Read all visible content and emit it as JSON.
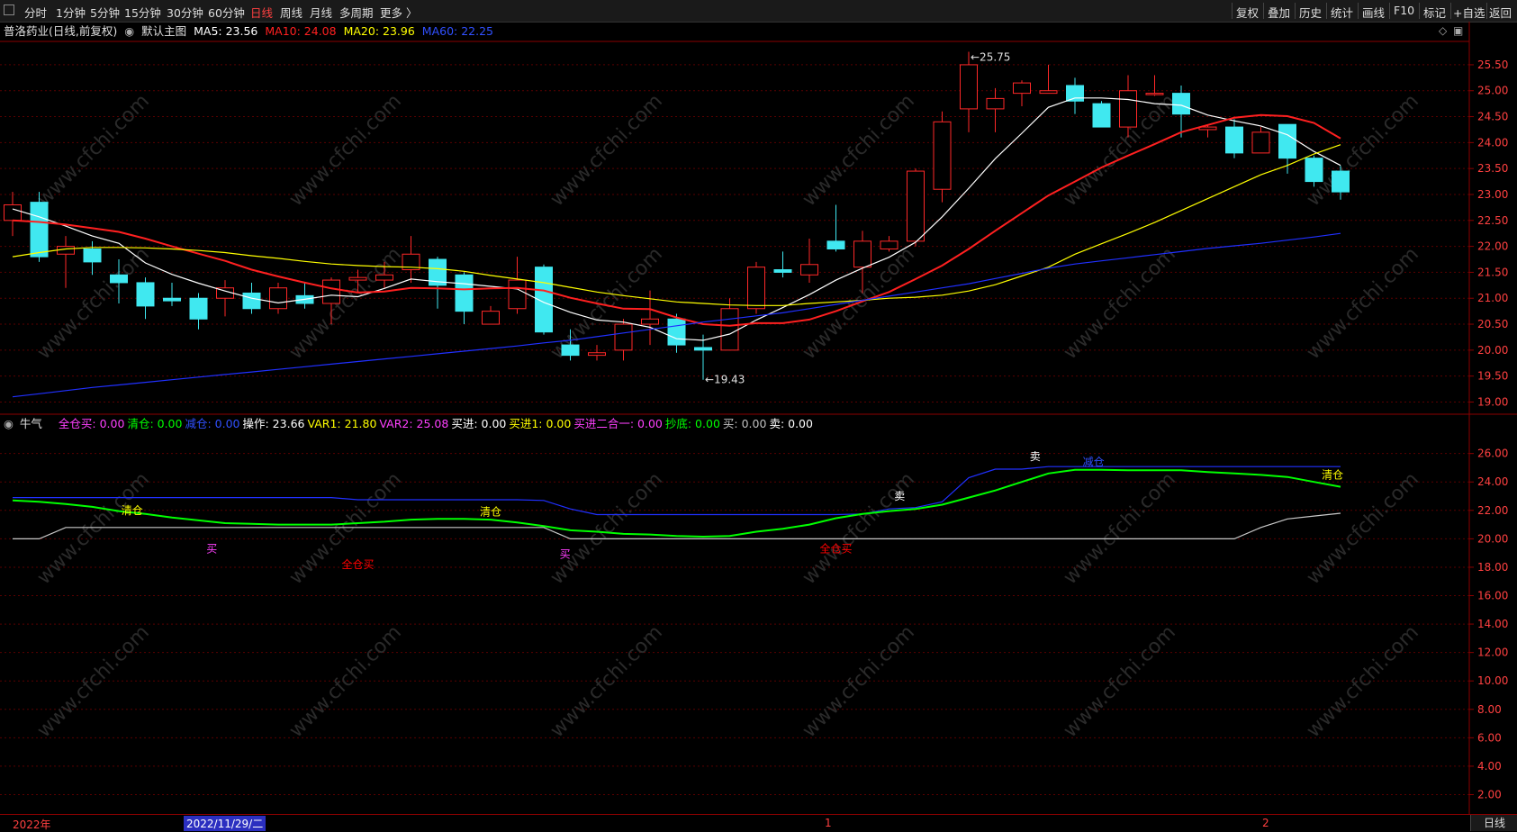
{
  "toolbar": {
    "periods": [
      "分时",
      "1分钟",
      "5分钟",
      "15分钟",
      "30分钟",
      "60分钟",
      "日线",
      "周线",
      "月线",
      "多周期",
      "更多 〉"
    ],
    "active_period": "日线",
    "right_buttons": [
      "复权",
      "叠加",
      "历史",
      "统计",
      "画线",
      "F10",
      "标记",
      "+自选",
      "返回"
    ]
  },
  "main_legend": {
    "title": "普洛药业(日线,前复权)",
    "chart_name": "默认主图",
    "ma5": "MA5: 23.56",
    "ma10": "MA10: 24.08",
    "ma20": "MA20: 23.96",
    "ma60": "MA60: 22.25"
  },
  "indicator_legend": {
    "name": "牛气",
    "items": [
      {
        "text": "全仓买: 0.00",
        "color": "#ff40ff"
      },
      {
        "text": "清仓: 0.00",
        "color": "#00ff00"
      },
      {
        "text": "减仓: 0.00",
        "color": "#3050ff"
      },
      {
        "text": "操作: 23.66",
        "color": "#ffffff"
      },
      {
        "text": "VAR1: 21.80",
        "color": "#ffff00"
      },
      {
        "text": "VAR2: 25.08",
        "color": "#ff40ff"
      },
      {
        "text": "买进: 0.00",
        "color": "#ffffff"
      },
      {
        "text": "买进1: 0.00",
        "color": "#ffff00"
      },
      {
        "text": "买进二合一: 0.00",
        "color": "#ff40ff"
      },
      {
        "text": "抄底: 0.00",
        "color": "#00ff00"
      },
      {
        "text": "买: 0.00",
        "color": "#c0c0c0"
      },
      {
        "text": "卖: 0.00",
        "color": "#ffffff"
      }
    ]
  },
  "statusbar": {
    "year_label": "2022年",
    "cursor_date": "2022/11/29/二",
    "month_marks": [
      "1",
      "2"
    ],
    "period_label": "日线"
  },
  "chart_data": [
    {
      "type": "candlestick",
      "title": "普洛药业(日线,前复权)",
      "ylim": [
        18.8,
        25.95
      ],
      "y_ticks": [
        19.0,
        19.5,
        20.0,
        20.5,
        21.0,
        21.5,
        22.0,
        22.5,
        23.0,
        23.5,
        24.0,
        24.5,
        25.0,
        25.5
      ],
      "max_label": "25.75",
      "min_label": "19.43",
      "candles": [
        [
          22.5,
          22.8,
          22.2,
          23.05
        ],
        [
          22.85,
          21.8,
          21.7,
          23.05
        ],
        [
          21.85,
          22.0,
          21.2,
          22.2
        ],
        [
          21.95,
          21.7,
          21.45,
          22.1
        ],
        [
          21.45,
          21.3,
          20.9,
          21.75
        ],
        [
          21.3,
          20.85,
          20.6,
          21.4
        ],
        [
          21.0,
          20.95,
          20.85,
          21.3
        ],
        [
          21.0,
          20.6,
          20.4,
          21.1
        ],
        [
          21.0,
          21.2,
          20.65,
          21.35
        ],
        [
          21.1,
          20.8,
          20.7,
          21.3
        ],
        [
          20.8,
          21.2,
          20.7,
          21.3
        ],
        [
          21.05,
          20.9,
          20.8,
          21.3
        ],
        [
          20.9,
          21.35,
          20.5,
          21.4
        ],
        [
          21.35,
          21.4,
          21.1,
          21.55
        ],
        [
          21.35,
          21.45,
          21.2,
          21.7
        ],
        [
          21.55,
          21.85,
          21.3,
          22.2
        ],
        [
          21.75,
          21.25,
          20.8,
          21.8
        ],
        [
          21.45,
          20.75,
          20.5,
          21.5
        ],
        [
          20.5,
          20.75,
          20.5,
          20.85
        ],
        [
          20.8,
          21.35,
          20.7,
          21.8
        ],
        [
          21.6,
          20.35,
          20.3,
          21.65
        ],
        [
          20.1,
          19.9,
          19.8,
          20.4
        ],
        [
          19.9,
          19.95,
          19.8,
          20.1
        ],
        [
          20.0,
          20.5,
          19.8,
          20.6
        ],
        [
          20.5,
          20.6,
          20.1,
          21.15
        ],
        [
          20.6,
          20.1,
          19.95,
          20.7
        ],
        [
          20.05,
          20.0,
          19.43,
          20.3
        ],
        [
          20.0,
          20.8,
          20.0,
          21.0
        ],
        [
          20.8,
          21.6,
          20.7,
          21.7
        ],
        [
          21.55,
          21.5,
          21.4,
          21.9
        ],
        [
          21.45,
          21.65,
          21.3,
          22.15
        ],
        [
          22.1,
          21.95,
          21.9,
          22.8
        ],
        [
          21.6,
          22.1,
          21.1,
          22.3
        ],
        [
          21.95,
          22.1,
          21.9,
          22.2
        ],
        [
          22.1,
          23.45,
          22.0,
          23.5
        ],
        [
          23.1,
          24.4,
          22.85,
          24.6
        ],
        [
          24.65,
          25.5,
          24.2,
          25.75
        ],
        [
          24.65,
          24.85,
          24.2,
          25.05
        ],
        [
          24.95,
          25.15,
          24.7,
          25.2
        ],
        [
          24.95,
          25.0,
          24.95,
          25.5
        ],
        [
          25.1,
          24.8,
          24.55,
          25.25
        ],
        [
          24.75,
          24.3,
          24.3,
          24.8
        ],
        [
          24.3,
          25.0,
          24.1,
          25.3
        ],
        [
          24.95,
          24.95,
          24.9,
          25.3
        ],
        [
          24.95,
          24.55,
          24.1,
          25.1
        ],
        [
          24.25,
          24.3,
          24.1,
          24.35
        ],
        [
          24.3,
          23.8,
          23.7,
          24.45
        ],
        [
          23.8,
          24.2,
          23.85,
          24.3
        ],
        [
          24.35,
          23.7,
          23.4,
          24.35
        ],
        [
          23.7,
          23.25,
          23.15,
          23.75
        ],
        [
          23.45,
          23.05,
          22.9,
          23.55
        ]
      ],
      "series": [
        {
          "name": "MA5",
          "color": "#ffffff",
          "values": [
            22.72,
            22.57,
            22.39,
            22.2,
            22.06,
            21.68,
            21.46,
            21.29,
            21.14,
            21.0,
            20.91,
            20.98,
            21.06,
            21.03,
            21.19,
            21.37,
            21.32,
            21.28,
            21.23,
            21.18,
            20.92,
            20.73,
            20.58,
            20.54,
            20.44,
            20.22,
            20.19,
            20.31,
            20.58,
            20.82,
            21.07,
            21.35,
            21.58,
            21.79,
            22.08,
            22.57,
            23.12,
            23.69,
            24.18,
            24.68,
            24.86,
            24.86,
            24.83,
            24.75,
            24.72,
            24.53,
            24.42,
            24.32,
            24.15,
            23.83,
            23.56
          ]
        },
        {
          "name": "MA10",
          "color": "#ff2020",
          "values": [
            22.5,
            22.47,
            22.42,
            22.35,
            22.28,
            22.15,
            22.0,
            21.86,
            21.72,
            21.55,
            21.42,
            21.3,
            21.19,
            21.11,
            21.13,
            21.2,
            21.19,
            21.17,
            21.19,
            21.2,
            21.15,
            21.01,
            20.9,
            20.8,
            20.79,
            20.63,
            20.5,
            20.47,
            20.52,
            20.52,
            20.59,
            20.75,
            20.94,
            21.12,
            21.37,
            21.63,
            21.95,
            22.3,
            22.64,
            22.98,
            23.25,
            23.52,
            23.75,
            23.97,
            24.2,
            24.34,
            24.48,
            24.53,
            24.51,
            24.38,
            24.08
          ]
        },
        {
          "name": "MA20",
          "color": "#ffff00",
          "values": [
            21.8,
            21.88,
            21.95,
            21.98,
            21.98,
            21.97,
            21.95,
            21.92,
            21.88,
            21.82,
            21.77,
            21.71,
            21.66,
            21.63,
            21.61,
            21.6,
            21.57,
            21.52,
            21.44,
            21.37,
            21.3,
            21.21,
            21.12,
            21.05,
            20.99,
            20.93,
            20.9,
            20.87,
            20.86,
            20.86,
            20.9,
            20.93,
            20.96,
            21.0,
            21.02,
            21.06,
            21.14,
            21.26,
            21.43,
            21.6,
            21.85,
            22.05,
            22.25,
            22.46,
            22.69,
            22.92,
            23.15,
            23.38,
            23.56,
            23.78,
            23.96
          ]
        },
        {
          "name": "MA60",
          "color": "#2030ff",
          "values": [
            19.1,
            19.16,
            19.22,
            19.28,
            19.33,
            19.38,
            19.43,
            19.48,
            19.53,
            19.58,
            19.63,
            19.68,
            19.73,
            19.78,
            19.83,
            19.88,
            19.93,
            19.98,
            20.03,
            20.08,
            20.14,
            20.19,
            20.26,
            20.33,
            20.4,
            20.47,
            20.54,
            20.6,
            20.66,
            20.72,
            20.8,
            20.88,
            20.96,
            21.04,
            21.12,
            21.2,
            21.28,
            21.38,
            21.48,
            21.58,
            21.66,
            21.72,
            21.78,
            21.84,
            21.9,
            21.96,
            22.01,
            22.06,
            22.12,
            22.18,
            22.25
          ]
        }
      ],
      "annotations": []
    },
    {
      "type": "line",
      "title": "牛气",
      "ylim": [
        0.7,
        27.5
      ],
      "y_ticks": [
        2.0,
        4.0,
        6.0,
        8.0,
        10.0,
        12.0,
        14.0,
        16.0,
        18.0,
        20.0,
        22.0,
        24.0,
        26.0
      ],
      "series": [
        {
          "name": "减仓",
          "color": "#2030ff",
          "values": [
            22.9,
            22.9,
            22.9,
            22.9,
            22.9,
            22.9,
            22.9,
            22.9,
            22.9,
            22.9,
            22.9,
            22.9,
            22.9,
            22.75,
            22.75,
            22.75,
            22.75,
            22.75,
            22.75,
            22.75,
            22.7,
            22.1,
            21.7,
            21.7,
            21.7,
            21.7,
            21.7,
            21.7,
            21.7,
            21.7,
            21.7,
            21.7,
            21.75,
            22.1,
            22.2,
            22.6,
            24.3,
            24.9,
            24.9,
            25.08,
            25.08,
            25.08,
            25.08,
            25.08,
            25.08,
            25.08,
            25.08,
            25.08,
            25.08,
            25.08,
            25.08
          ]
        },
        {
          "name": "清仓",
          "color": "#00ff00",
          "values": [
            22.7,
            22.6,
            22.45,
            22.25,
            21.95,
            21.75,
            21.5,
            21.3,
            21.1,
            21.05,
            21.0,
            21.0,
            21.0,
            21.1,
            21.2,
            21.35,
            21.4,
            21.4,
            21.35,
            21.15,
            20.9,
            20.6,
            20.5,
            20.35,
            20.3,
            20.2,
            20.15,
            20.2,
            20.5,
            20.7,
            21.0,
            21.45,
            21.75,
            21.95,
            22.1,
            22.4,
            22.9,
            23.4,
            24.0,
            24.6,
            24.85,
            24.85,
            24.82,
            24.82,
            24.82,
            24.7,
            24.6,
            24.5,
            24.35,
            24.0,
            23.66
          ]
        },
        {
          "name": "VAR1",
          "color": "#c8c8c8",
          "values": [
            20.0,
            20.0,
            20.8,
            20.8,
            20.8,
            20.8,
            20.8,
            20.8,
            20.8,
            20.8,
            20.8,
            20.8,
            20.8,
            20.8,
            20.8,
            20.8,
            20.8,
            20.8,
            20.8,
            20.8,
            20.8,
            20.0,
            20.0,
            20.0,
            20.0,
            20.0,
            20.0,
            20.0,
            20.0,
            20.0,
            20.0,
            20.0,
            20.0,
            20.0,
            20.0,
            20.0,
            20.0,
            20.0,
            20.0,
            20.0,
            20.0,
            20.0,
            20.0,
            20.0,
            20.0,
            20.0,
            20.0,
            20.8,
            21.4,
            21.6,
            21.8
          ]
        }
      ],
      "annotations": [
        {
          "text": "清仓",
          "color": "#ffff00",
          "i": 4.5,
          "v": 22.0
        },
        {
          "text": "买",
          "color": "#ff40ff",
          "i": 7.5,
          "v": 19.3
        },
        {
          "text": "全仓买",
          "color": "#ff0000",
          "i": 13.0,
          "v": 18.2
        },
        {
          "text": "清仓",
          "color": "#ffff00",
          "i": 18.0,
          "v": 21.9
        },
        {
          "text": "买",
          "color": "#ff40ff",
          "i": 20.8,
          "v": 18.9
        },
        {
          "text": "全仓买",
          "color": "#ff0000",
          "i": 31.0,
          "v": 19.3
        },
        {
          "text": "卖",
          "color": "#ffffff",
          "i": 33.4,
          "v": 23.0
        },
        {
          "text": "卖",
          "color": "#ffffff",
          "i": 38.5,
          "v": 25.8
        },
        {
          "text": "减仓",
          "color": "#3050ff",
          "i": 40.7,
          "v": 25.4
        },
        {
          "text": "清仓",
          "color": "#ffff00",
          "i": 49.7,
          "v": 24.5
        }
      ]
    }
  ],
  "watermark": "www.cfchi.com"
}
